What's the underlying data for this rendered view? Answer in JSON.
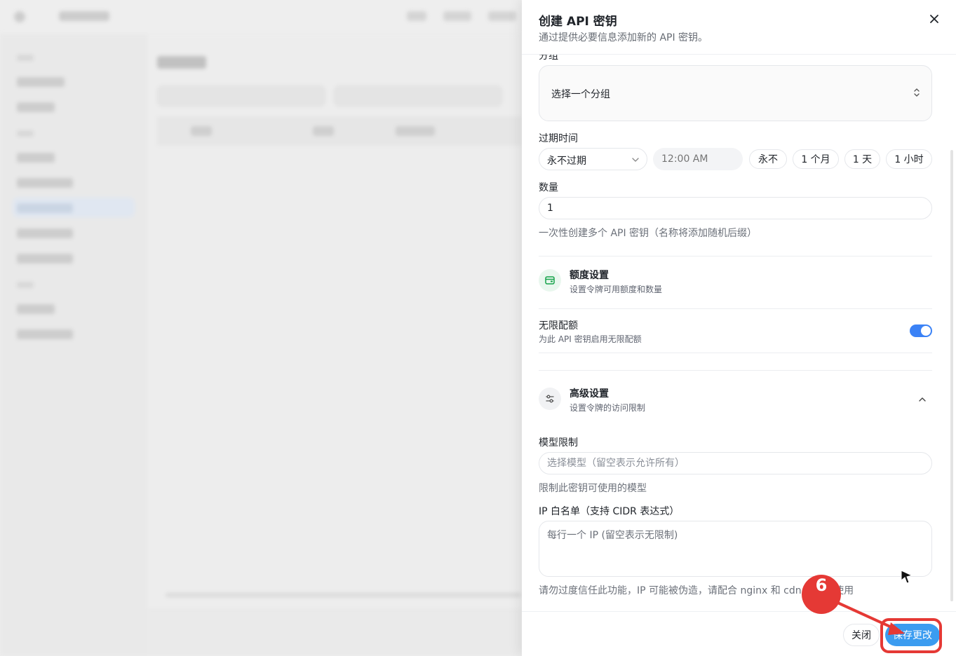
{
  "dialog": {
    "title": "创建 API 密钥",
    "description": "通过提供必要信息添加新的 API 密钥。"
  },
  "form": {
    "group": {
      "label": "分组",
      "value": "选择一个分组"
    },
    "expiry": {
      "label": "过期时间",
      "select_value": "永不过期",
      "time_placeholder": "12:00 AM",
      "presets": [
        "永不",
        "1 个月",
        "1 天",
        "1 小时"
      ]
    },
    "quantity": {
      "label": "数量",
      "value": "1",
      "hint": "一次性创建多个 API 密钥（名称将添加随机后缀）"
    },
    "quota_section": {
      "title": "额度设置",
      "subtitle": "设置令牌可用额度和数量"
    },
    "unlimited": {
      "label": "无限配额",
      "description": "为此 API 密钥启用无限配额",
      "enabled": true
    },
    "advanced_section": {
      "title": "高级设置",
      "subtitle": "设置令牌的访问限制"
    },
    "model_limit": {
      "label": "模型限制",
      "placeholder": "选择模型（留空表示允许所有）",
      "hint": "限制此密钥可使用的模型"
    },
    "ip_whitelist": {
      "label": "IP 白名单（支持 CIDR 表达式）",
      "placeholder": "每行一个 IP (留空表示无限制)",
      "hint": "请勿过度信任此功能，IP 可能被伪造，请配合 nginx 和 cdn 等网关使用"
    }
  },
  "footer": {
    "close_label": "关闭",
    "save_label": "保存更改"
  },
  "annotation": {
    "step_number": "6"
  },
  "colors": {
    "accent": "#3b82f6",
    "save_button": "#3b9cf0",
    "annotation_red": "#e53935",
    "quota_icon": "#16a34a"
  }
}
